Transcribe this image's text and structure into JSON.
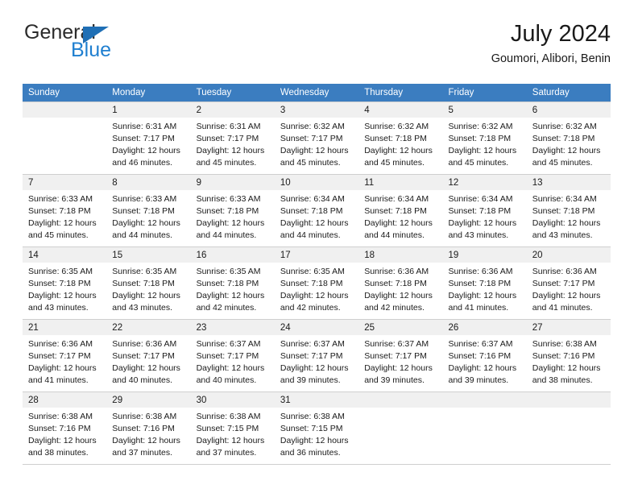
{
  "brand": {
    "name_top": "General",
    "name_bottom": "Blue",
    "color_dark": "#2b2b2b",
    "color_blue": "#1f7fd0",
    "triangle_color": "#1f6fb5"
  },
  "header": {
    "title": "July 2024",
    "subtitle": "Goumori, Alibori, Benin"
  },
  "theme": {
    "header_bg": "#3b7dc0",
    "header_text": "#ffffff",
    "daynum_bg": "#f0f0f0",
    "grid_line": "#cfcfcf"
  },
  "weekdays": [
    "Sunday",
    "Monday",
    "Tuesday",
    "Wednesday",
    "Thursday",
    "Friday",
    "Saturday"
  ],
  "labels": {
    "sunrise_prefix": "Sunrise:",
    "sunset_prefix": "Sunset:",
    "daylight_prefix": "Daylight:"
  },
  "weeks": [
    [
      {
        "day": "",
        "empty": true
      },
      {
        "day": "1",
        "sunrise": "Sunrise: 6:31 AM",
        "sunset": "Sunset: 7:17 PM",
        "daylight_line1": "Daylight: 12 hours",
        "daylight_line2": "and 46 minutes."
      },
      {
        "day": "2",
        "sunrise": "Sunrise: 6:31 AM",
        "sunset": "Sunset: 7:17 PM",
        "daylight_line1": "Daylight: 12 hours",
        "daylight_line2": "and 45 minutes."
      },
      {
        "day": "3",
        "sunrise": "Sunrise: 6:32 AM",
        "sunset": "Sunset: 7:17 PM",
        "daylight_line1": "Daylight: 12 hours",
        "daylight_line2": "and 45 minutes."
      },
      {
        "day": "4",
        "sunrise": "Sunrise: 6:32 AM",
        "sunset": "Sunset: 7:18 PM",
        "daylight_line1": "Daylight: 12 hours",
        "daylight_line2": "and 45 minutes."
      },
      {
        "day": "5",
        "sunrise": "Sunrise: 6:32 AM",
        "sunset": "Sunset: 7:18 PM",
        "daylight_line1": "Daylight: 12 hours",
        "daylight_line2": "and 45 minutes."
      },
      {
        "day": "6",
        "sunrise": "Sunrise: 6:32 AM",
        "sunset": "Sunset: 7:18 PM",
        "daylight_line1": "Daylight: 12 hours",
        "daylight_line2": "and 45 minutes."
      }
    ],
    [
      {
        "day": "7",
        "sunrise": "Sunrise: 6:33 AM",
        "sunset": "Sunset: 7:18 PM",
        "daylight_line1": "Daylight: 12 hours",
        "daylight_line2": "and 45 minutes."
      },
      {
        "day": "8",
        "sunrise": "Sunrise: 6:33 AM",
        "sunset": "Sunset: 7:18 PM",
        "daylight_line1": "Daylight: 12 hours",
        "daylight_line2": "and 44 minutes."
      },
      {
        "day": "9",
        "sunrise": "Sunrise: 6:33 AM",
        "sunset": "Sunset: 7:18 PM",
        "daylight_line1": "Daylight: 12 hours",
        "daylight_line2": "and 44 minutes."
      },
      {
        "day": "10",
        "sunrise": "Sunrise: 6:34 AM",
        "sunset": "Sunset: 7:18 PM",
        "daylight_line1": "Daylight: 12 hours",
        "daylight_line2": "and 44 minutes."
      },
      {
        "day": "11",
        "sunrise": "Sunrise: 6:34 AM",
        "sunset": "Sunset: 7:18 PM",
        "daylight_line1": "Daylight: 12 hours",
        "daylight_line2": "and 44 minutes."
      },
      {
        "day": "12",
        "sunrise": "Sunrise: 6:34 AM",
        "sunset": "Sunset: 7:18 PM",
        "daylight_line1": "Daylight: 12 hours",
        "daylight_line2": "and 43 minutes."
      },
      {
        "day": "13",
        "sunrise": "Sunrise: 6:34 AM",
        "sunset": "Sunset: 7:18 PM",
        "daylight_line1": "Daylight: 12 hours",
        "daylight_line2": "and 43 minutes."
      }
    ],
    [
      {
        "day": "14",
        "sunrise": "Sunrise: 6:35 AM",
        "sunset": "Sunset: 7:18 PM",
        "daylight_line1": "Daylight: 12 hours",
        "daylight_line2": "and 43 minutes."
      },
      {
        "day": "15",
        "sunrise": "Sunrise: 6:35 AM",
        "sunset": "Sunset: 7:18 PM",
        "daylight_line1": "Daylight: 12 hours",
        "daylight_line2": "and 43 minutes."
      },
      {
        "day": "16",
        "sunrise": "Sunrise: 6:35 AM",
        "sunset": "Sunset: 7:18 PM",
        "daylight_line1": "Daylight: 12 hours",
        "daylight_line2": "and 42 minutes."
      },
      {
        "day": "17",
        "sunrise": "Sunrise: 6:35 AM",
        "sunset": "Sunset: 7:18 PM",
        "daylight_line1": "Daylight: 12 hours",
        "daylight_line2": "and 42 minutes."
      },
      {
        "day": "18",
        "sunrise": "Sunrise: 6:36 AM",
        "sunset": "Sunset: 7:18 PM",
        "daylight_line1": "Daylight: 12 hours",
        "daylight_line2": "and 42 minutes."
      },
      {
        "day": "19",
        "sunrise": "Sunrise: 6:36 AM",
        "sunset": "Sunset: 7:18 PM",
        "daylight_line1": "Daylight: 12 hours",
        "daylight_line2": "and 41 minutes."
      },
      {
        "day": "20",
        "sunrise": "Sunrise: 6:36 AM",
        "sunset": "Sunset: 7:17 PM",
        "daylight_line1": "Daylight: 12 hours",
        "daylight_line2": "and 41 minutes."
      }
    ],
    [
      {
        "day": "21",
        "sunrise": "Sunrise: 6:36 AM",
        "sunset": "Sunset: 7:17 PM",
        "daylight_line1": "Daylight: 12 hours",
        "daylight_line2": "and 41 minutes."
      },
      {
        "day": "22",
        "sunrise": "Sunrise: 6:36 AM",
        "sunset": "Sunset: 7:17 PM",
        "daylight_line1": "Daylight: 12 hours",
        "daylight_line2": "and 40 minutes."
      },
      {
        "day": "23",
        "sunrise": "Sunrise: 6:37 AM",
        "sunset": "Sunset: 7:17 PM",
        "daylight_line1": "Daylight: 12 hours",
        "daylight_line2": "and 40 minutes."
      },
      {
        "day": "24",
        "sunrise": "Sunrise: 6:37 AM",
        "sunset": "Sunset: 7:17 PM",
        "daylight_line1": "Daylight: 12 hours",
        "daylight_line2": "and 39 minutes."
      },
      {
        "day": "25",
        "sunrise": "Sunrise: 6:37 AM",
        "sunset": "Sunset: 7:17 PM",
        "daylight_line1": "Daylight: 12 hours",
        "daylight_line2": "and 39 minutes."
      },
      {
        "day": "26",
        "sunrise": "Sunrise: 6:37 AM",
        "sunset": "Sunset: 7:16 PM",
        "daylight_line1": "Daylight: 12 hours",
        "daylight_line2": "and 39 minutes."
      },
      {
        "day": "27",
        "sunrise": "Sunrise: 6:38 AM",
        "sunset": "Sunset: 7:16 PM",
        "daylight_line1": "Daylight: 12 hours",
        "daylight_line2": "and 38 minutes."
      }
    ],
    [
      {
        "day": "28",
        "sunrise": "Sunrise: 6:38 AM",
        "sunset": "Sunset: 7:16 PM",
        "daylight_line1": "Daylight: 12 hours",
        "daylight_line2": "and 38 minutes."
      },
      {
        "day": "29",
        "sunrise": "Sunrise: 6:38 AM",
        "sunset": "Sunset: 7:16 PM",
        "daylight_line1": "Daylight: 12 hours",
        "daylight_line2": "and 37 minutes."
      },
      {
        "day": "30",
        "sunrise": "Sunrise: 6:38 AM",
        "sunset": "Sunset: 7:15 PM",
        "daylight_line1": "Daylight: 12 hours",
        "daylight_line2": "and 37 minutes."
      },
      {
        "day": "31",
        "sunrise": "Sunrise: 6:38 AM",
        "sunset": "Sunset: 7:15 PM",
        "daylight_line1": "Daylight: 12 hours",
        "daylight_line2": "and 36 minutes."
      },
      {
        "day": "",
        "empty": true
      },
      {
        "day": "",
        "empty": true
      },
      {
        "day": "",
        "empty": true
      }
    ]
  ]
}
